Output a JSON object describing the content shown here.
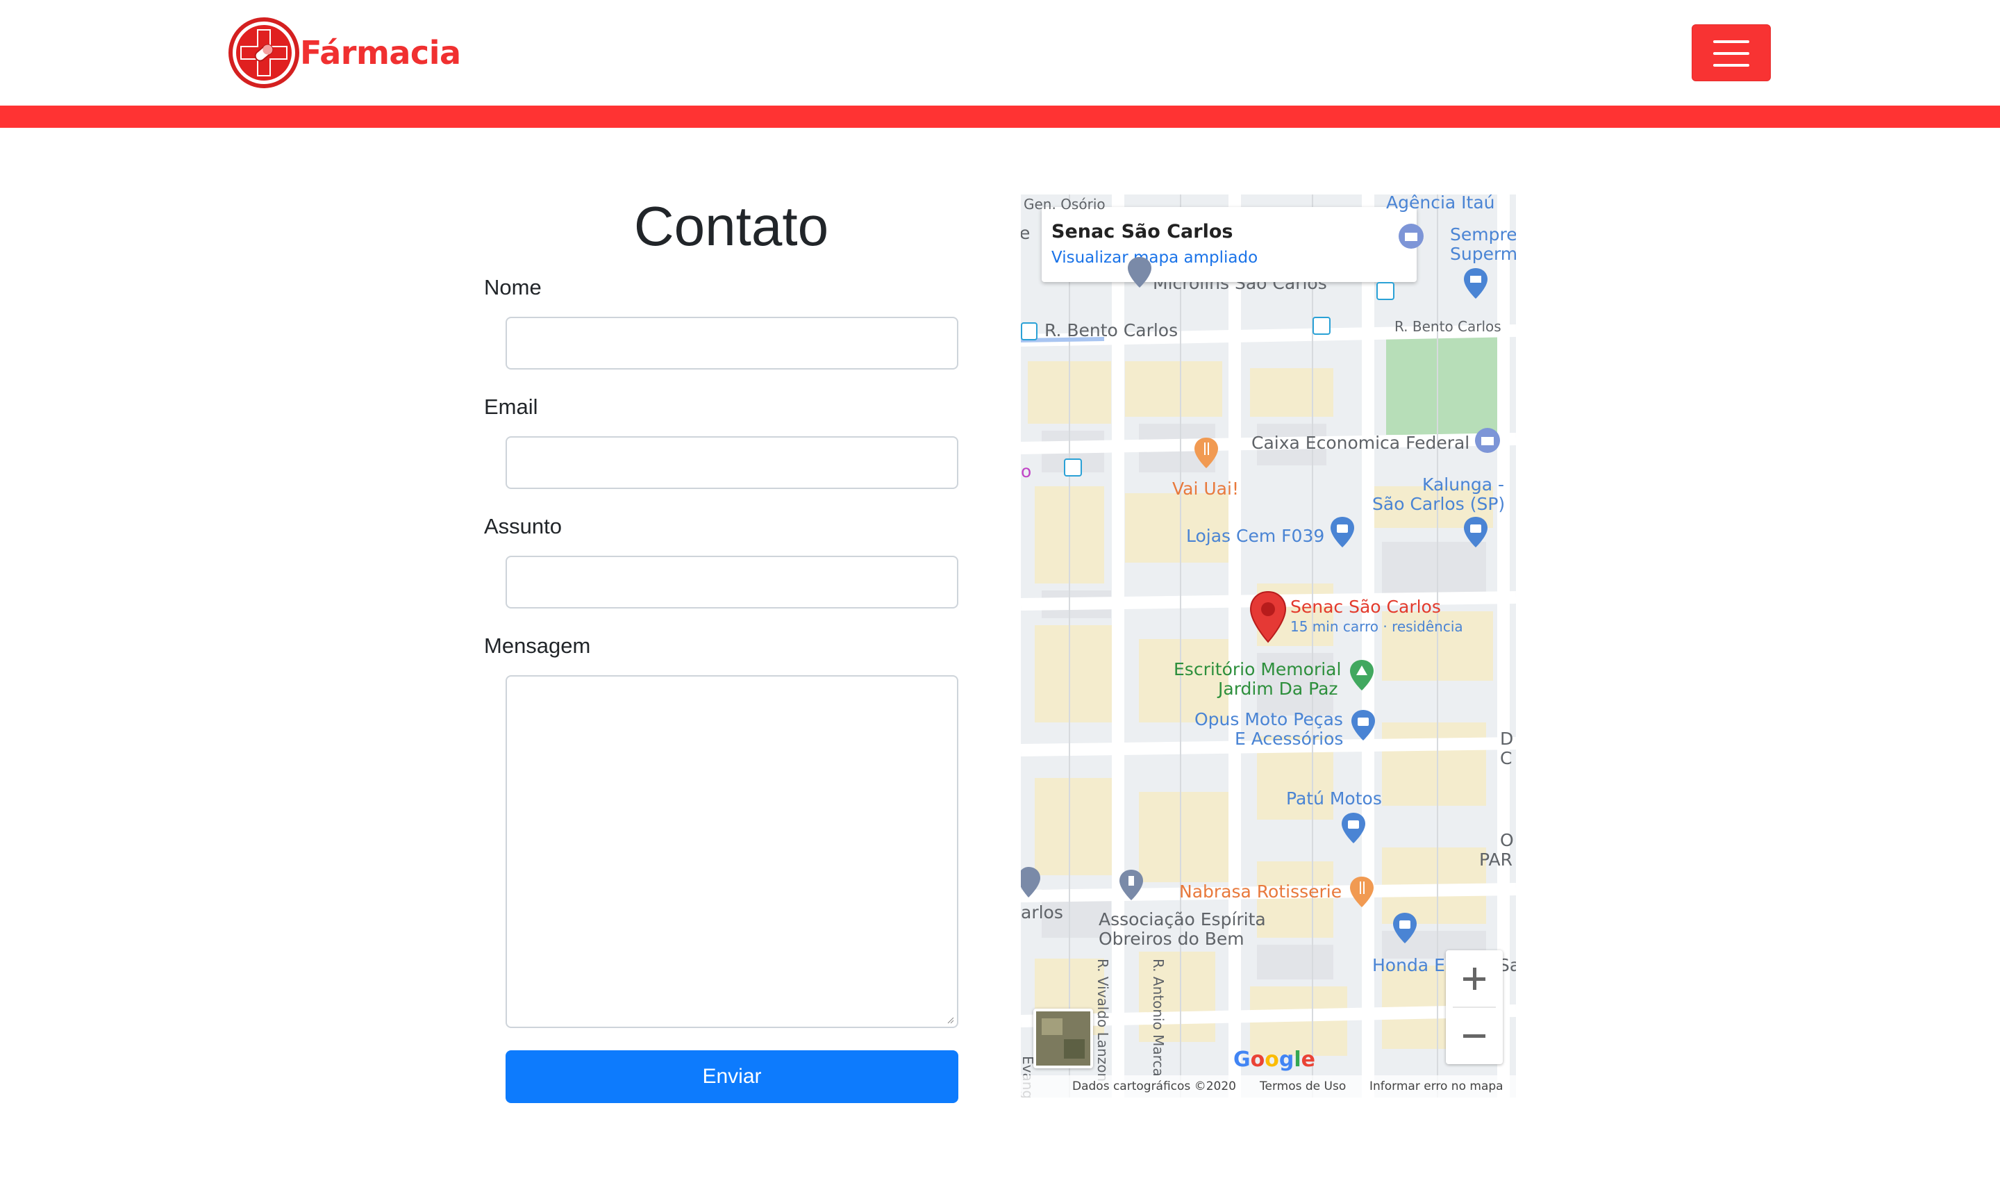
{
  "header": {
    "brand_name": "Fármacia",
    "logo": "pharmacy-cross-pill-logo",
    "menu_icon": "hamburger-icon",
    "accent_color": "#ff3333"
  },
  "contact": {
    "title": "Contato",
    "fields": {
      "name_label": "Nome",
      "email_label": "Email",
      "subject_label": "Assunto",
      "message_label": "Mensagem",
      "name_value": "",
      "email_value": "",
      "subject_value": "",
      "message_value": ""
    },
    "submit_label": "Enviar",
    "submit_color": "#0d7bfd"
  },
  "map": {
    "info_title": "Senac São Carlos",
    "info_link": "Visualizar mapa ampliado",
    "marker_name": "Senac São Carlos",
    "marker_sub": "15 min carro · residência",
    "places": {
      "gen_osorio": "Gen. Osório",
      "agencia_itau": "Agência Itaú",
      "sempre_1": "Sempre",
      "sempre_2": "Superm",
      "microlins": "Microlins São Carlos",
      "bento_carlos_left": "R. Bento Carlos",
      "bento_carlos_right": "R. Bento Carlos",
      "caixa": "Caixa Economica Federal",
      "vai_uai": "Vai Uai!",
      "kalunga_1": "Kalunga -",
      "kalunga_2": "São Carlos (SP)",
      "lojas_cem": "Lojas Cem F039",
      "escritorio_1": "Escritório Memorial",
      "escritorio_2": "Jardim Da Paz",
      "opus_1": "Opus Moto Peças",
      "opus_2": "E Acessórios",
      "patu_motos": "Patú Motos",
      "nabrasa": "Nabrasa Rotisserie",
      "associacao_1": "Associação Espírita",
      "associacao_2": "Obreiros do Bem",
      "honda": "Honda E",
      "arlos": "arlos",
      "vivaldo": "R. Vivaldo Lanzon",
      "antonio": "R. Antonio Marca",
      "evang": "Evang",
      "d_c_1": "D",
      "d_c_2": "C",
      "o_par_1": "O",
      "o_par_2": "PAR",
      "sa": "Sa",
      "e_left": "e",
      "o_left": "o"
    },
    "google_logo": "Google",
    "footer_data": "Dados cartográficos ©2020",
    "footer_terms": "Termos de Uso",
    "footer_report": "Informar erro no mapa",
    "zoom_in_icon": "plus-icon",
    "zoom_out_icon": "minus-icon"
  }
}
